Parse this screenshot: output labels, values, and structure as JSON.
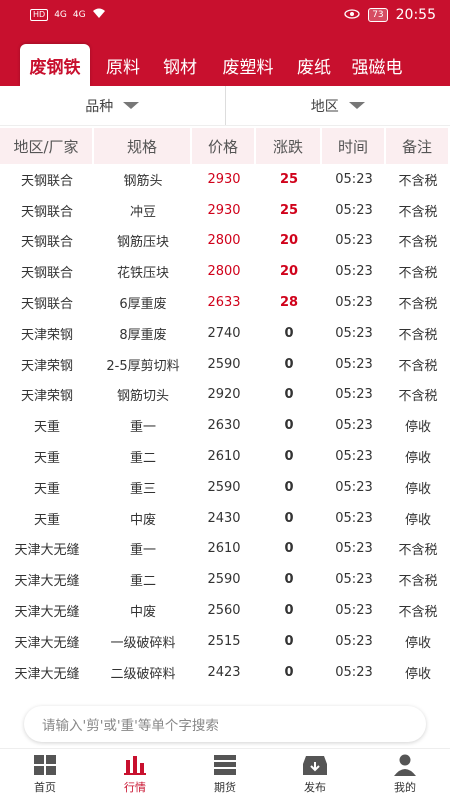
{
  "status_bar": {
    "left_icons": "HD",
    "signal1": "4G",
    "signal2": "4G",
    "battery": "73",
    "time": "20:55"
  },
  "tabs": [
    "废钢铁",
    "原料",
    "钢材",
    "废塑料",
    "废纸",
    "强磁电"
  ],
  "filters": {
    "variety": "品种",
    "region": "地区"
  },
  "table": {
    "headers": [
      "地区/厂家",
      "规格",
      "价格",
      "涨跌",
      "时间",
      "备注"
    ],
    "rows": [
      [
        "天钢联合",
        "钢筋头",
        "2930",
        "25",
        "05:23",
        "不含税"
      ],
      [
        "天钢联合",
        "冲豆",
        "2930",
        "25",
        "05:23",
        "不含税"
      ],
      [
        "天钢联合",
        "钢筋压块",
        "2800",
        "20",
        "05:23",
        "不含税"
      ],
      [
        "天钢联合",
        "花铁压块",
        "2800",
        "20",
        "05:23",
        "不含税"
      ],
      [
        "天钢联合",
        "6厚重废",
        "2633",
        "28",
        "05:23",
        "不含税"
      ],
      [
        "天津荣钢",
        "8厚重废",
        "2740",
        "0",
        "05:23",
        "不含税"
      ],
      [
        "天津荣钢",
        "2-5厚剪切料",
        "2590",
        "0",
        "05:23",
        "不含税"
      ],
      [
        "天津荣钢",
        "钢筋切头",
        "2920",
        "0",
        "05:23",
        "不含税"
      ],
      [
        "天重",
        "重一",
        "2630",
        "0",
        "05:23",
        "停收"
      ],
      [
        "天重",
        "重二",
        "2610",
        "0",
        "05:23",
        "停收"
      ],
      [
        "天重",
        "重三",
        "2590",
        "0",
        "05:23",
        "停收"
      ],
      [
        "天重",
        "中废",
        "2430",
        "0",
        "05:23",
        "停收"
      ],
      [
        "天津大无缝",
        "重一",
        "2610",
        "0",
        "05:23",
        "不含税"
      ],
      [
        "天津大无缝",
        "重二",
        "2590",
        "0",
        "05:23",
        "不含税"
      ],
      [
        "天津大无缝",
        "中废",
        "2560",
        "0",
        "05:23",
        "不含税"
      ],
      [
        "天津大无缝",
        "一级破碎料",
        "2515",
        "0",
        "05:23",
        "停收"
      ],
      [
        "天津大无缝",
        "二级破碎料",
        "2423",
        "0",
        "05:23",
        "停收"
      ]
    ]
  },
  "search": {
    "placeholder": "请输入'剪'或'重'等单个字搜索"
  },
  "bottom_nav": [
    {
      "label": "首页",
      "icon": "home-grid-icon"
    },
    {
      "label": "行情",
      "icon": "market-chart-icon"
    },
    {
      "label": "期货",
      "icon": "futures-list-icon"
    },
    {
      "label": "发布",
      "icon": "publish-box-icon"
    },
    {
      "label": "我的",
      "icon": "profile-person-icon"
    }
  ],
  "colors": {
    "brand": "#c8102e",
    "price_up": "#d0021b",
    "header_bg": "#fbeef0"
  }
}
